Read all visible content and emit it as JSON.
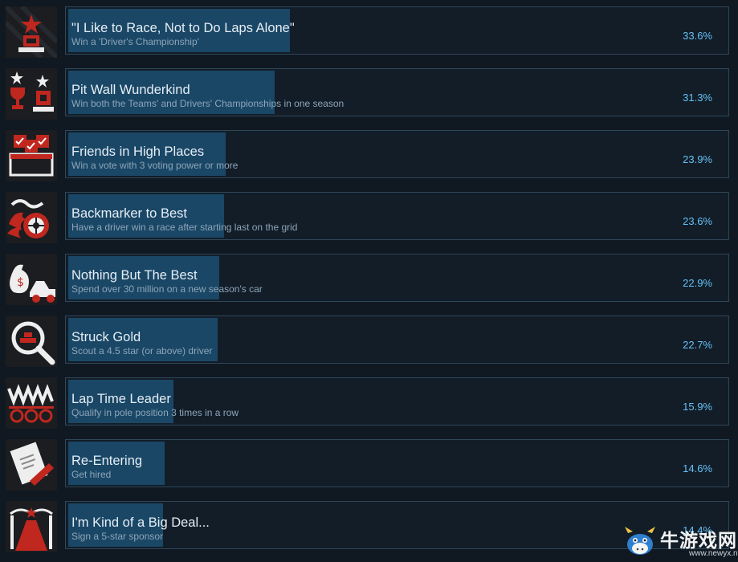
{
  "achievements": [
    {
      "title": "\"I Like to Race, Not to Do Laps Alone\"",
      "description": "Win a 'Driver's Championship'",
      "percent_label": "33.6%",
      "percent": 33.6,
      "icon": "trophy-podium-icon"
    },
    {
      "title": "Pit Wall Wunderkind",
      "description": "Win both the Teams' and Drivers' Championships in one season",
      "percent_label": "31.3%",
      "percent": 31.3,
      "icon": "double-trophy-icon"
    },
    {
      "title": "Friends in High Places",
      "description": "Win a vote with 3 voting power or more",
      "percent_label": "23.9%",
      "percent": 23.9,
      "icon": "ballot-box-icon"
    },
    {
      "title": "Backmarker to Best",
      "description": "Have a driver win a race after starting last on the grid",
      "percent_label": "23.6%",
      "percent": 23.6,
      "icon": "flaming-wheel-icon"
    },
    {
      "title": "Nothing But The Best",
      "description": "Spend over 30 million on a new season's car",
      "percent_label": "22.9%",
      "percent": 22.9,
      "icon": "money-bag-car-icon"
    },
    {
      "title": "Struck Gold",
      "description": "Scout a 4.5 star (or above) driver",
      "percent_label": "22.7%",
      "percent": 22.7,
      "icon": "magnifier-gold-icon"
    },
    {
      "title": "Lap Time Leader",
      "description": "Qualify in pole position 3 times in a row",
      "percent_label": "15.9%",
      "percent": 15.9,
      "icon": "lap-timer-icon"
    },
    {
      "title": "Re-Entering",
      "description": "Get hired",
      "percent_label": "14.6%",
      "percent": 14.6,
      "icon": "contract-signing-icon"
    },
    {
      "title": "I'm Kind of a Big Deal...",
      "description": "Sign a 5-star sponsor",
      "percent_label": "14.4%",
      "percent": 14.4,
      "icon": "red-carpet-icon"
    }
  ],
  "colors": {
    "background": "#101822",
    "bar_fill": "#1a4766",
    "panel_border": "#2e4759",
    "percent_text": "#66c0f4",
    "icon_red": "#c0271f"
  },
  "watermark": {
    "text": "牛游戏网",
    "url": "www.newyx.net",
    "icon": "cow-logo-icon"
  }
}
